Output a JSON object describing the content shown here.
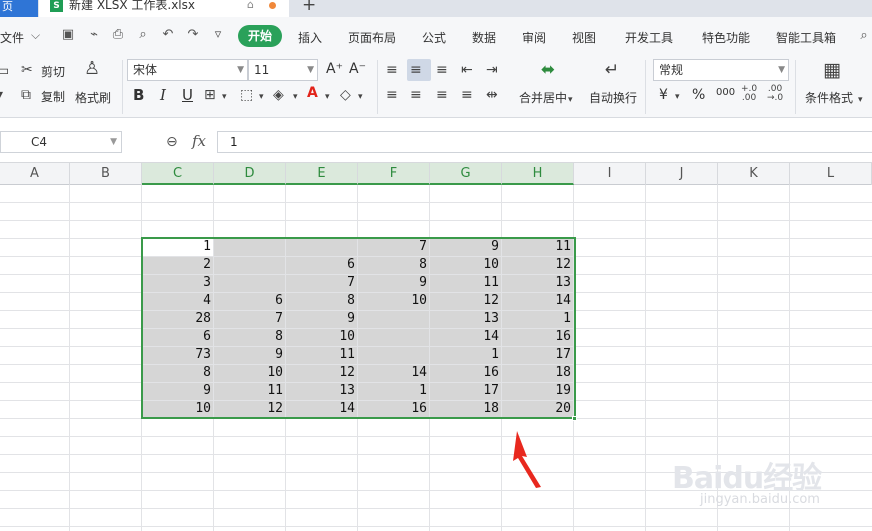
{
  "tabs": {
    "home_label": "页",
    "file_icon_label": "S",
    "file_name": "新建 XLSX 工作表.xlsx",
    "new_tab_label": "+"
  },
  "menu": {
    "file_label": "文件",
    "items": [
      "开始",
      "插入",
      "页面布局",
      "公式",
      "数据",
      "审阅",
      "视图",
      "开发工具",
      "特色功能",
      "智能工具箱"
    ]
  },
  "ribbon": {
    "cut_label": "剪切",
    "copy_label": "复制",
    "format_painter_label": "格式刷",
    "font_name": "宋体",
    "font_size": "11",
    "merge_center_label": "合并居中",
    "wrap_text_label": "自动换行",
    "number_format": "常规",
    "conditional_format_label": "条件格式",
    "bold_label": "B",
    "italic_label": "I",
    "underline_label": "U",
    "font_grow_label": "A⁺",
    "font_shrink_label": "A⁻",
    "percent_label": "%",
    "thousands_label": "000",
    "currency_label": "¥"
  },
  "formula_bar": {
    "name_box": "C4",
    "fx_label": "fx",
    "formula_value": "1"
  },
  "columns": [
    "A",
    "B",
    "C",
    "D",
    "E",
    "F",
    "G",
    "H",
    "I",
    "J",
    "K",
    "L"
  ],
  "selected_columns": [
    "C",
    "D",
    "E",
    "F",
    "G",
    "H"
  ],
  "rows": [
    [
      "1",
      "",
      "",
      "7",
      "9",
      "11"
    ],
    [
      "2",
      "",
      "6",
      "8",
      "10",
      "12"
    ],
    [
      "3",
      "",
      "7",
      "9",
      "11",
      "13"
    ],
    [
      "4",
      "6",
      "8",
      "10",
      "12",
      "14"
    ],
    [
      "28",
      "7",
      "9",
      "",
      "13",
      "1"
    ],
    [
      "6",
      "8",
      "10",
      "",
      "14",
      "16"
    ],
    [
      "73",
      "9",
      "11",
      "",
      "1",
      "17"
    ],
    [
      "8",
      "10",
      "12",
      "14",
      "16",
      "18"
    ],
    [
      "9",
      "11",
      "13",
      "1",
      "17",
      "19"
    ],
    [
      "10",
      "12",
      "14",
      "16",
      "18",
      "20"
    ]
  ],
  "colors": {
    "accent_green": "#3a9a4a",
    "selection_fill": "#d6d6d6",
    "annotation_arrow": "#e8281e"
  },
  "watermark": {
    "text": "Baidu经验",
    "url": "jingyan.baidu.com"
  }
}
